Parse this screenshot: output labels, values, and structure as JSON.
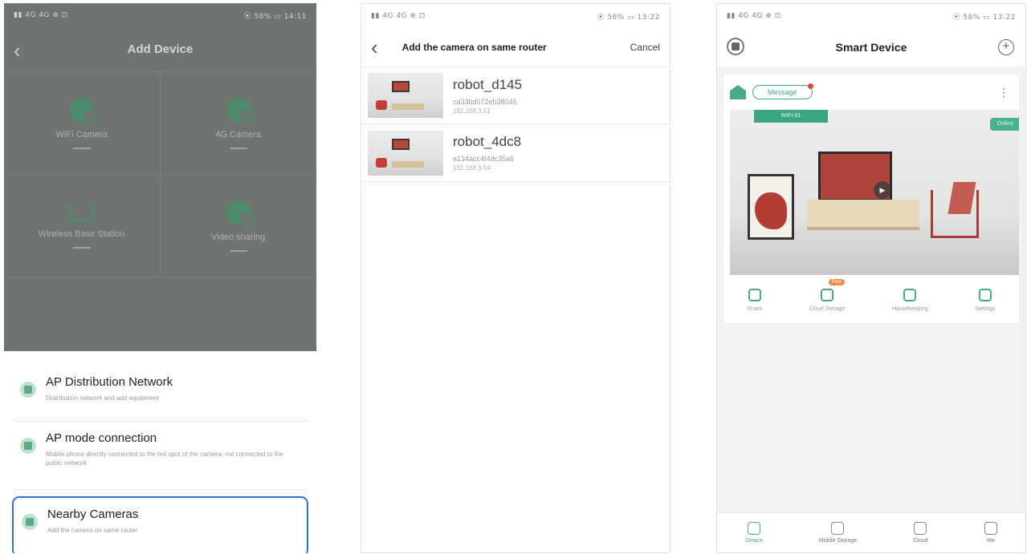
{
  "phone1": {
    "status": {
      "left": "▮▮ 4G 4G ⊕ ⊡",
      "right": "⦿ 58% ▭ 14:11"
    },
    "header": {
      "back_icon": "chevron-left-icon",
      "title": "Add Device"
    },
    "grid": [
      {
        "label": "WiFi Camera",
        "icon": "wifi-camera-icon"
      },
      {
        "label": "4G Camera",
        "icon": "4g-camera-icon"
      },
      {
        "label": "Wireless Base Station",
        "icon": "base-station-icon"
      },
      {
        "label": "Video sharing",
        "icon": "video-share-icon"
      }
    ],
    "sheet": {
      "options": [
        {
          "title": "AP Distribution Network",
          "desc": "Distribution network and add equipment",
          "icon": "ap-network-icon"
        },
        {
          "title": "AP mode connection",
          "desc": "Mobile phone directly connected to the hot spot of the camera, not connected to the public network",
          "icon": "ap-mode-icon"
        },
        {
          "title": "Nearby Cameras",
          "desc": "Add the camera on same router",
          "icon": "nearby-camera-icon"
        }
      ]
    }
  },
  "phone2": {
    "status": {
      "left": "▮▮ 4G 4G ⊕ ⊡",
      "right": "⦿ 58% ▭ 13:22"
    },
    "header": {
      "back_icon": "chevron-left-icon",
      "title": "Add the camera on same router",
      "cancel": "Cancel"
    },
    "devices": [
      {
        "name": "robot_d145",
        "id": "cd33bd072eb38046",
        "ip": "192.168.3.51"
      },
      {
        "name": "robot_4dc8",
        "id": "a134acc4f4dc35a6",
        "ip": "192.168.3.54"
      }
    ]
  },
  "phone3": {
    "status": {
      "left": "▮▮ 4G 4G ⊕ ⊡",
      "right": "⦿ 58% ▭ 13:22"
    },
    "header": {
      "title": "Smart Device",
      "left_icon": "scan-icon",
      "right_icon": "add-circle-icon"
    },
    "card": {
      "message": "Message",
      "more_icon": "more-vertical-icon",
      "tag_left": "WIFI-01",
      "tag_right": "Online",
      "actions": [
        {
          "label": "Share",
          "icon": "share-icon",
          "badge": ""
        },
        {
          "label": "Cloud Storage",
          "icon": "cloud-storage-icon",
          "badge": "Free"
        },
        {
          "label": "Housekeeping",
          "icon": "home-icon",
          "badge": ""
        },
        {
          "label": "Settings",
          "icon": "settings-icon",
          "badge": ""
        }
      ]
    },
    "tabs": [
      {
        "label": "Device",
        "icon": "device-icon",
        "active": true
      },
      {
        "label": "Mobile Storage",
        "icon": "storage-icon",
        "active": false
      },
      {
        "label": "Cloud",
        "icon": "cloud-icon",
        "active": false
      },
      {
        "label": "Me",
        "icon": "user-icon",
        "active": false
      }
    ]
  },
  "colors": {
    "accent": "#47ab82",
    "highlight": "#2f74c5",
    "overlay": "#6f7471"
  }
}
